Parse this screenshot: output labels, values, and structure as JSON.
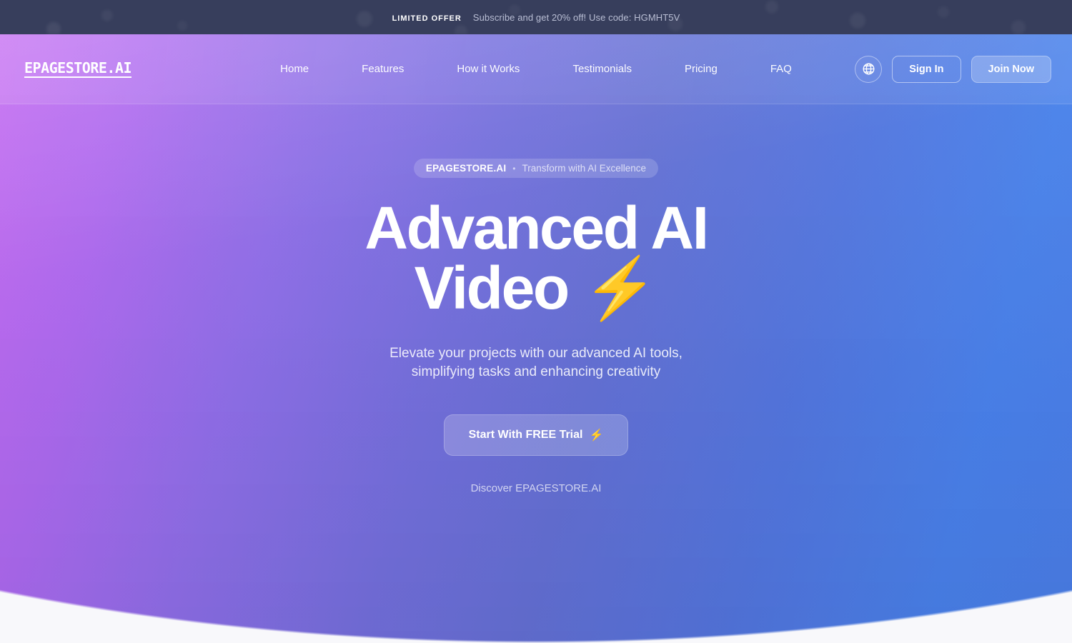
{
  "promo_bar": {
    "tag": "LIMITED OFFER",
    "message": "Subscribe and get 20% off! Use code: HGMHT5V"
  },
  "navbar": {
    "logo": "EPAGESTORE.AI",
    "links": [
      {
        "label": "Home"
      },
      {
        "label": "Features"
      },
      {
        "label": "How it Works"
      },
      {
        "label": "Testimonials"
      },
      {
        "label": "Pricing"
      },
      {
        "label": "FAQ"
      }
    ],
    "language_icon": "globe-icon",
    "sign_in_label": "Sign In",
    "join_now_label": "Join Now"
  },
  "hero": {
    "badge": {
      "brand": "EPAGESTORE.AI",
      "separator": "•",
      "tagline": "Transform with AI Excellence"
    },
    "headline_line1": "Advanced AI",
    "headline_line2": "Video",
    "headline_bolt": "⚡",
    "subtitle": "Elevate your projects with our advanced AI tools, simplifying tasks and enhancing creativity",
    "cta_label": "Start With FREE Trial",
    "cta_bolt": "⚡",
    "discover_label": "Discover EPAGESTORE.AI"
  },
  "colors": {
    "promo_bar_bg": "#373e5c",
    "gradient_start": "#c56cf3",
    "gradient_mid": "#6672d6",
    "gradient_end": "#4b80e9",
    "page_bg": "#f8f8fb",
    "text_on_hero": "#ffffff"
  }
}
